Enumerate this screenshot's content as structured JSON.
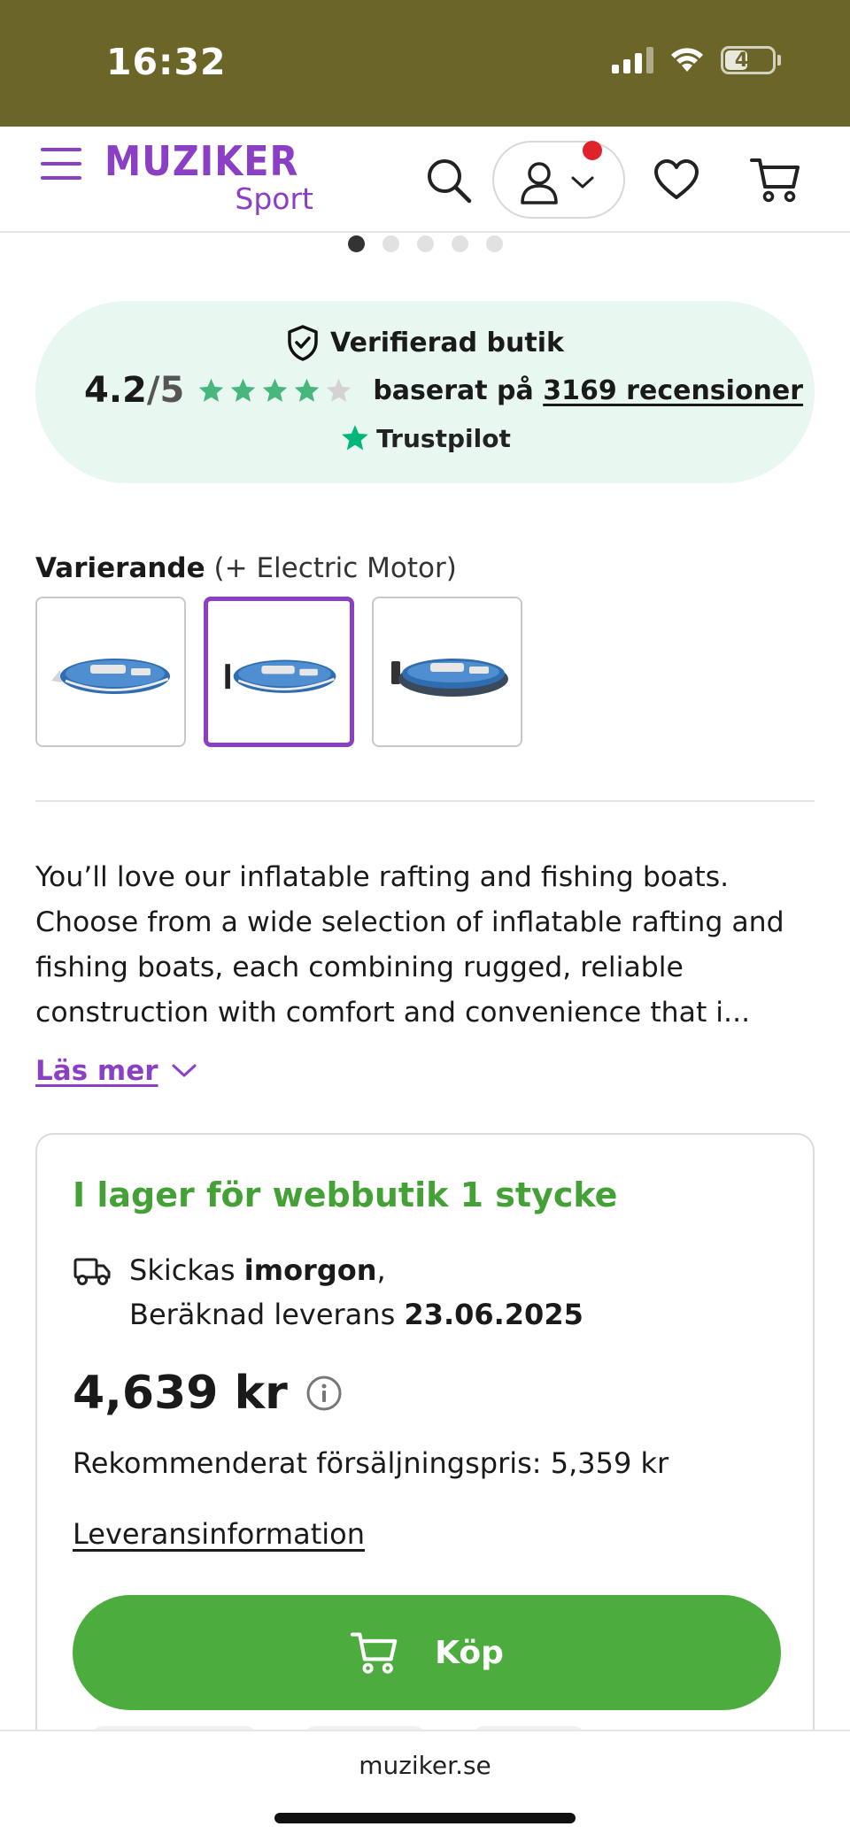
{
  "status_bar": {
    "time": "16:32",
    "battery": "44"
  },
  "header": {
    "logo_main": "MUZIKER",
    "logo_sub": "Sport",
    "icons": [
      "menu-icon",
      "search-icon",
      "user-icon",
      "chevron-down-icon",
      "heart-icon",
      "cart-icon"
    ],
    "brand_color": "#8a3fc4",
    "notification_color": "#e0222c"
  },
  "gallery": {
    "dots_total": 5,
    "active_index": 0
  },
  "trust": {
    "verified_label": "Verifierad butik",
    "score": "4.2",
    "score_max": "/5",
    "rating_value": 4.2,
    "based_on": "baserat på",
    "reviews_link": "3169 recensioner",
    "provider": "Trustpilot",
    "star_color": "#48b77d"
  },
  "variant": {
    "label": "Varierande",
    "extra": "(+ Electric Motor)",
    "selected_index": 1,
    "thumbnails": [
      "boat-variant-1",
      "boat-variant-2",
      "boat-variant-3"
    ]
  },
  "description": {
    "text": "You’ll love our inflatable rafting and fishing boats. Choose from a wide selection of inflatable rafting and fishing boats, each combining rugged, reliable construction with comfort and convenience that i...",
    "read_more": "Läs mer"
  },
  "purchase": {
    "stock": "I lager för webbutik 1 stycke",
    "ship_prefix": "Skickas ",
    "ship_day": "imorgon",
    "ship_suffix": ",",
    "delivery_prefix": "Beräknad leverans ",
    "delivery_date": "23.06.2025",
    "price": "4,639 kr",
    "rrp": "Rekommenderat försäljningspris: 5,359 kr",
    "delivery_info_link": "Leveransinformation",
    "buy_label": "Köp",
    "accent_color": "#4cac3e"
  },
  "browser": {
    "url": "muziker.se"
  }
}
